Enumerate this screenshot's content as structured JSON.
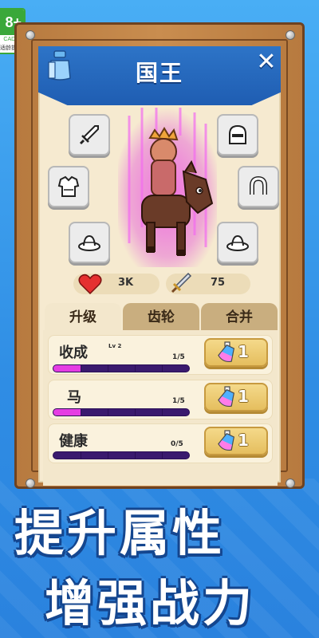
{
  "age_rating": {
    "top": "8+",
    "org": "CADPA",
    "note": "适龄提示"
  },
  "panel": {
    "title": "国王",
    "close": "✕"
  },
  "slots": {
    "left": [
      "sword-icon",
      "armor-icon",
      "hat-icon"
    ],
    "right": [
      "helmet-icon",
      "horseshoe-icon",
      "hat-icon"
    ]
  },
  "stats": {
    "health": "3K",
    "attack": "75"
  },
  "tabs": [
    {
      "label": "升级",
      "active": true
    },
    {
      "label": "齿轮",
      "active": false
    },
    {
      "label": "合并",
      "active": false
    }
  ],
  "upgrades": [
    {
      "name": "收成",
      "level": "Lv 2",
      "count": "1/5",
      "progress": 0.2,
      "cost": "1"
    },
    {
      "name": "马",
      "level": "",
      "count": "1/5",
      "progress": 0.2,
      "cost": "1"
    },
    {
      "name": "健康",
      "level": "",
      "count": "0/5",
      "progress": 0.0,
      "cost": "1"
    }
  ],
  "promo": {
    "line1": "提升属性",
    "line2": "增强战力"
  },
  "colors": {
    "accent_blue": "#2d74c7",
    "progress_fill": "#e53de3",
    "progress_track": "#3a1a6e",
    "button_gold": "#e5be5e"
  }
}
